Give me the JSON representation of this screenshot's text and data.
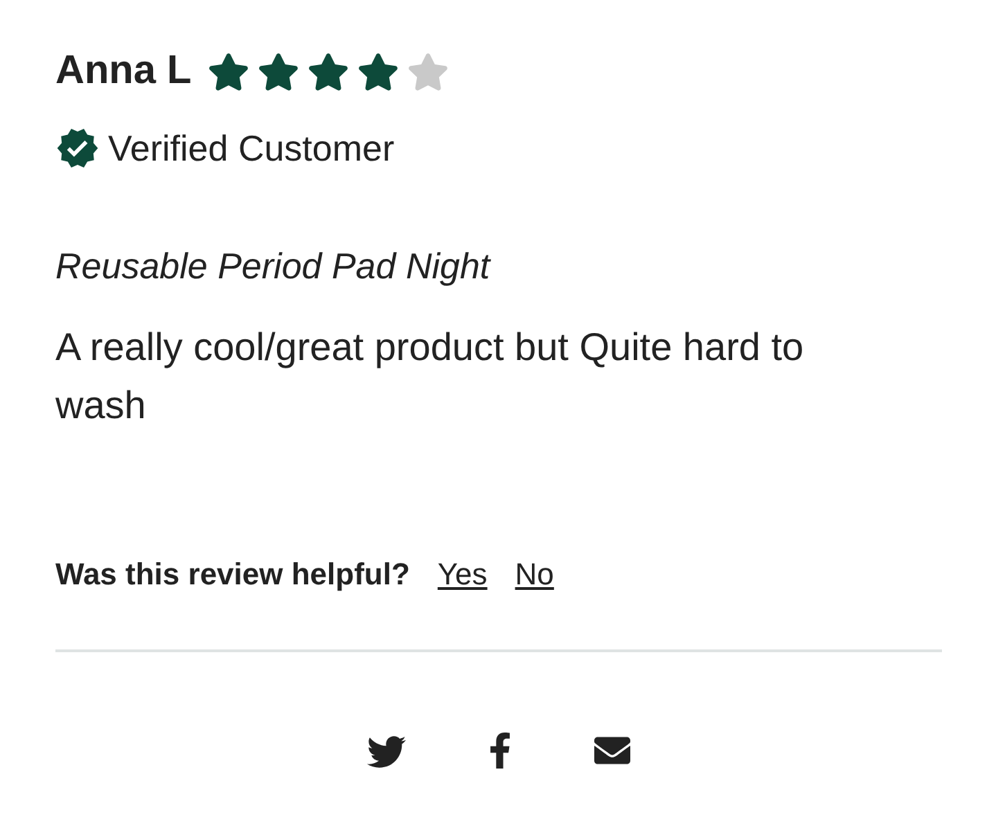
{
  "review": {
    "author": "Anna L",
    "stars": 4,
    "verified": true,
    "verified_label": "Verified Customer",
    "product": "Reusable Period Pad Night",
    "body": "A really cool/great product but Quite hard to wash"
  },
  "helpful": {
    "question": "Was this review helpful?",
    "options": [
      "Yes",
      "No"
    ]
  }
}
